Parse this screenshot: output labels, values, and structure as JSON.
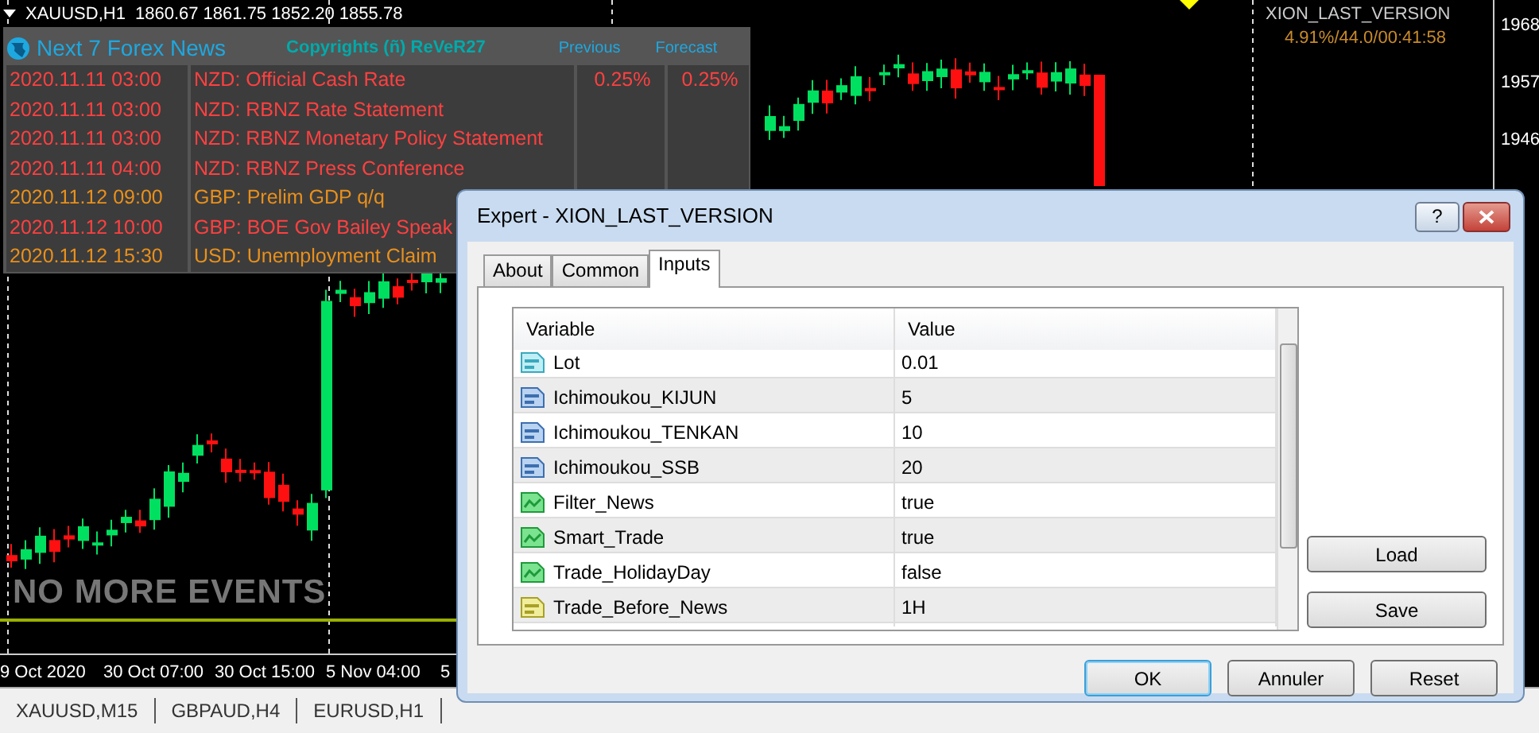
{
  "chart": {
    "symbol": "XAUUSD,H1",
    "ohlc": "1860.67 1861.75 1852.20 1855.78",
    "ea_name": "XION_LAST_VERSION",
    "ea_status": "4.91%/44.0/00:41:58",
    "price_labels": [
      "1968",
      "1957",
      "1946"
    ],
    "time_labels": [
      "9 Oct 2020",
      "30 Oct 07:00",
      "30 Oct 15:00",
      "5 Nov 04:00",
      "5"
    ],
    "status_text": "NO MORE EVENTS"
  },
  "news_panel": {
    "title": "Next 7 Forex News",
    "copyright": "Copyrights (ñ) ReVeR27",
    "columns": [
      "Previous",
      "Forecast"
    ],
    "events": [
      {
        "time": "2020.11.11 03:00",
        "event": "NZD: Official Cash Rate",
        "previous": "0.25%",
        "forecast": "0.25%",
        "color": "#ff4040"
      },
      {
        "time": "2020.11.11 03:00",
        "event": "NZD: RBNZ Rate Statement",
        "color": "#ff4040"
      },
      {
        "time": "2020.11.11 03:00",
        "event": "NZD: RBNZ Monetary Policy Statement",
        "color": "#ff4040"
      },
      {
        "time": "2020.11.11 04:00",
        "event": "NZD: RBNZ Press Conference",
        "color": "#ff4040"
      },
      {
        "time": "2020.11.12 09:00",
        "event": "GBP: Prelim GDP q/q",
        "color": "#e8901c"
      },
      {
        "time": "2020.11.12 10:00",
        "event": "GBP: BOE Gov Bailey Speak",
        "color": "#ff4040"
      },
      {
        "time": "2020.11.12 15:30",
        "event": "USD: Unemployment Claim",
        "color": "#e8901c"
      }
    ]
  },
  "dialog": {
    "title": "Expert - XION_LAST_VERSION",
    "help_button": "?",
    "tabs": [
      {
        "label": "About",
        "selected": false
      },
      {
        "label": "Common",
        "selected": false
      },
      {
        "label": "Inputs",
        "selected": true
      }
    ],
    "columns": [
      "Variable",
      "Value"
    ],
    "inputs": [
      {
        "kind": "double",
        "variable": "Lot",
        "value": "0.01"
      },
      {
        "kind": "int",
        "variable": "Ichimoukou_KIJUN",
        "value": "5"
      },
      {
        "kind": "int",
        "variable": "Ichimoukou_TENKAN",
        "value": "10"
      },
      {
        "kind": "int",
        "variable": "Ichimoukou_SSB",
        "value": "20"
      },
      {
        "kind": "bool",
        "variable": "Filter_News",
        "value": "true"
      },
      {
        "kind": "bool",
        "variable": "Smart_Trade",
        "value": "true"
      },
      {
        "kind": "bool",
        "variable": "Trade_HolidayDay",
        "value": "false"
      },
      {
        "kind": "string",
        "variable": "Trade_Before_News",
        "value": "1H"
      }
    ],
    "side_buttons": [
      "Load",
      "Save"
    ],
    "buttons": [
      {
        "label": "OK",
        "default": true
      },
      {
        "label": "Annuler",
        "default": false
      },
      {
        "label": "Reset",
        "default": false
      }
    ]
  },
  "chart_tabs": [
    "XAUUSD,M15",
    "GBPAUD,H4",
    "EURUSD,H1"
  ]
}
